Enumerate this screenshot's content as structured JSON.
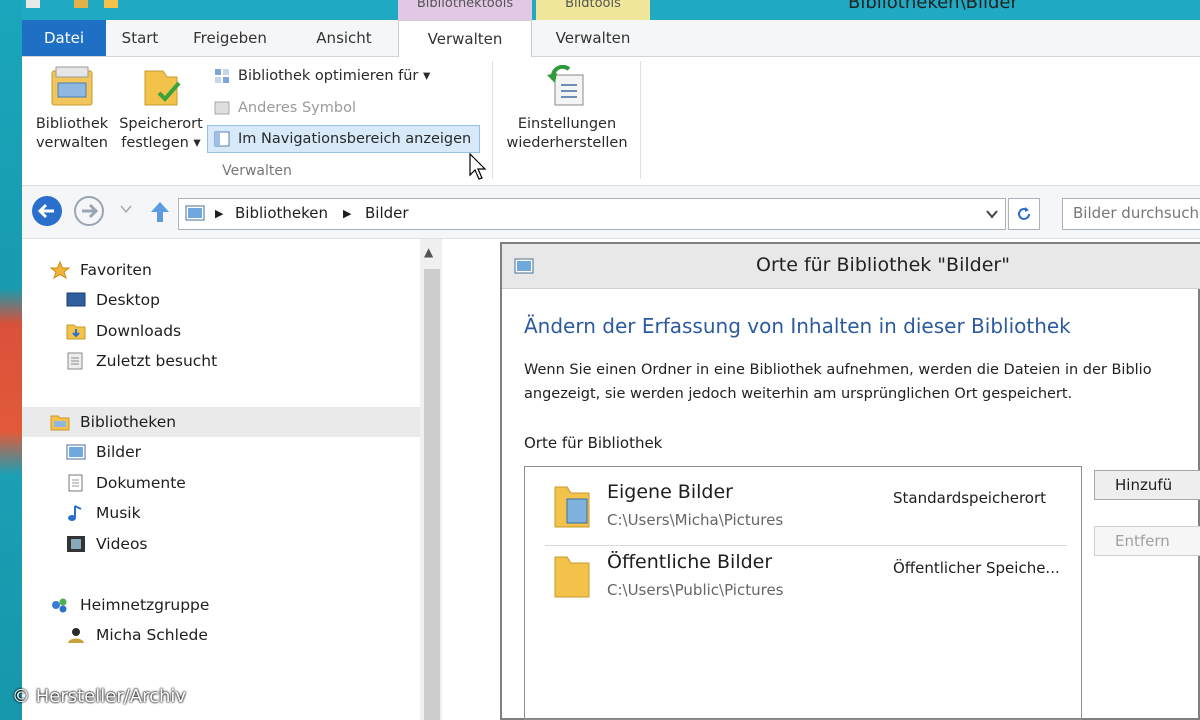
{
  "window": {
    "title": "Bibliotheken\\Bilder",
    "contextual_tabs": [
      "Bibliothektools",
      "Bildtools"
    ]
  },
  "ribbon_tabs": [
    "Datei",
    "Start",
    "Freigeben",
    "Ansicht",
    "Verwalten",
    "Verwalten"
  ],
  "ribbon": {
    "bibliothek_verwalten": [
      "Bibliothek",
      "verwalten"
    ],
    "speicherort_festlegen": [
      "Speicherort",
      "festlegen ▾"
    ],
    "optimieren": "Bibliothek optimieren für ▾",
    "anderes_symbol": "Anderes Symbol",
    "navigationsbereich": "Im Navigationsbereich anzeigen",
    "group_label": "Verwalten",
    "einstellungen": [
      "Einstellungen",
      "wiederherstellen"
    ]
  },
  "address": {
    "crumbs": [
      "Bibliotheken",
      "Bilder"
    ],
    "search_placeholder": "Bilder durchsuchen"
  },
  "nav": {
    "favoriten": "Favoriten",
    "desktop": "Desktop",
    "downloads": "Downloads",
    "zuletzt": "Zuletzt besucht",
    "bibliotheken": "Bibliotheken",
    "bilder": "Bilder",
    "dokumente": "Dokumente",
    "musik": "Musik",
    "videos": "Videos",
    "heimnetzgruppe": "Heimnetzgruppe",
    "user": "Micha Schlede"
  },
  "dialog": {
    "title": "Orte für Bibliothek \"Bilder\"",
    "heading": "Ändern der Erfassung von Inhalten in dieser Bibliothek",
    "text1": "Wenn Sie einen Ordner in eine Bibliothek aufnehmen, werden die Dateien in der Biblio",
    "text2": "angezeigt, sie werden jedoch weiterhin am ursprünglichen Ort gespeichert.",
    "list_label": "Orte für Bibliothek",
    "locations": [
      {
        "name": "Eigene Bilder",
        "path": "C:\\Users\\Micha\\Pictures",
        "status": "Standardspeicherort"
      },
      {
        "name": "Öffentliche Bilder",
        "path": "C:\\Users\\Public\\Pictures",
        "status": "Öffentlicher Speiche..."
      }
    ],
    "add_button": "Hinzufü",
    "remove_button": "Entfern"
  },
  "watermark": "© Hersteller/Archiv"
}
